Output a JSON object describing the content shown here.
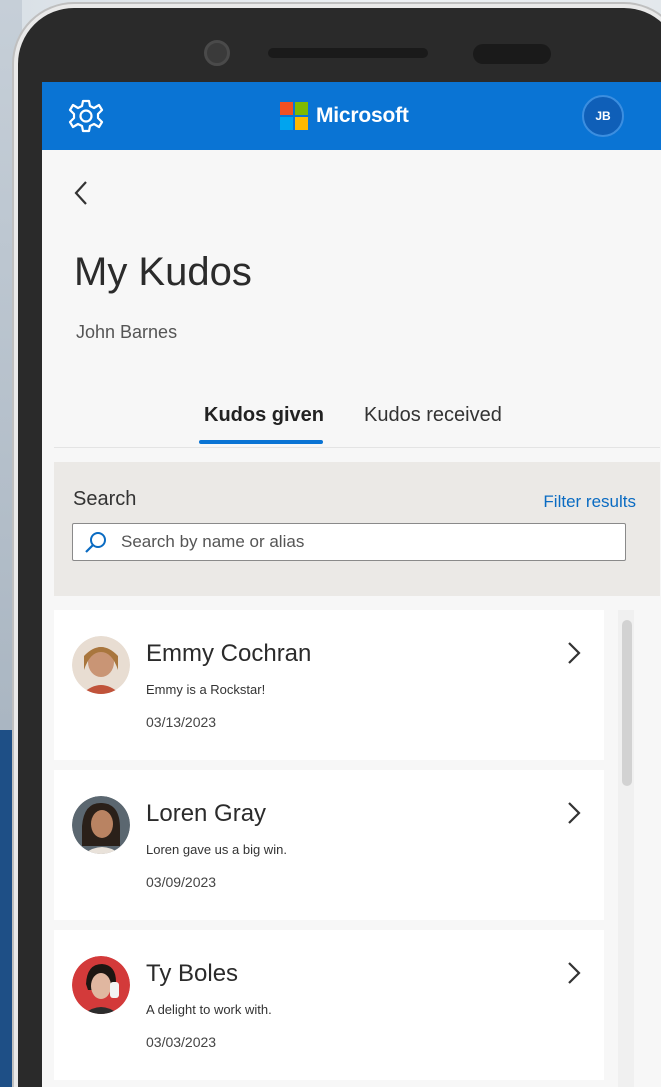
{
  "app": {
    "brand": "Microsoft",
    "user_initials": "JB",
    "accent_color": "#0a74d4",
    "logo_colors": [
      "#f25022",
      "#7fba00",
      "#00a4ef",
      "#ffb900"
    ]
  },
  "page": {
    "title": "My Kudos",
    "user_name": "John Barnes"
  },
  "tabs": [
    {
      "label": "Kudos given",
      "active": true
    },
    {
      "label": "Kudos received",
      "active": false
    }
  ],
  "search": {
    "label": "Search",
    "filter_link": "Filter results",
    "placeholder": "Search by name or alias"
  },
  "kudos": [
    {
      "name": "Emmy Cochran",
      "message": "Emmy is a Rockstar!",
      "date": "03/13/2023",
      "avatar_color": "#c9a27a"
    },
    {
      "name": "Loren Gray",
      "message": "Loren gave us a big win.",
      "date": "03/09/2023",
      "avatar_color": "#6b4a3a"
    },
    {
      "name": "Ty Boles",
      "message": "A delight to work with.",
      "date": "03/03/2023",
      "avatar_color": "#c23a3a"
    }
  ]
}
